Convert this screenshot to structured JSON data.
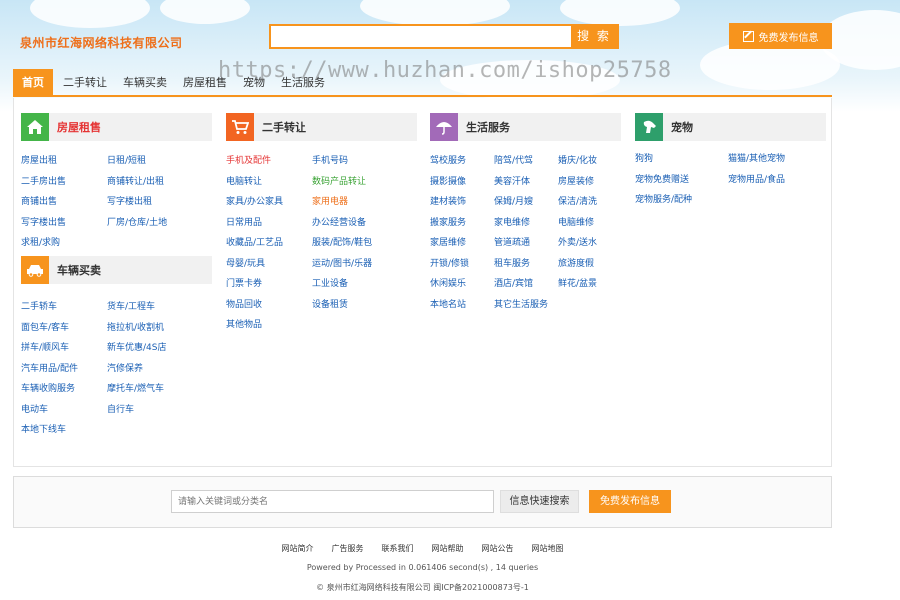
{
  "header": {
    "site_title": "泉州市红海网络科技有限公司",
    "search_placeholder": "",
    "search_button": "搜 索",
    "publish_button": "免费发布信息"
  },
  "watermark": "https://www.huzhan.com/ishop25758",
  "nav": {
    "items": [
      "首页",
      "二手转让",
      "车辆买卖",
      "房屋租售",
      "宠物",
      "生活服务"
    ]
  },
  "categories": {
    "house": {
      "title": "房屋租售",
      "links": [
        "房屋出租",
        "日租/短租",
        "二手房出售",
        "商铺转让/出租",
        "商铺出售",
        "写字楼出租",
        "写字楼出售",
        "厂房/仓库/土地",
        "求租/求购"
      ]
    },
    "vehicle": {
      "title": "车辆买卖",
      "links": [
        "二手轿车",
        "货车/工程车",
        "面包车/客车",
        "拖拉机/收割机",
        "拼车/顺风车",
        "新车优惠/4S店",
        "汽车用品/配件",
        "汽修保养",
        "车辆收购服务",
        "摩托车/燃气车",
        "电动车",
        "自行车",
        "本地下线车"
      ]
    },
    "secondhand": {
      "title": "二手转让",
      "links": [
        "手机及配件",
        "手机号码",
        "电脑转让",
        "数码产品转让",
        "家具/办公家具",
        "家用电器",
        "日常用品",
        "办公经营设备",
        "收藏品/工艺品",
        "服装/配饰/鞋包",
        "母婴/玩具",
        "运动/图书/乐器",
        "门票卡券",
        "工业设备",
        "物品回收",
        "设备租赁",
        "其他物品"
      ]
    },
    "life": {
      "title": "生活服务",
      "links": [
        "驾校服务",
        "陪驾/代驾",
        "婚庆/化妆",
        "摄影摄像",
        "美容汗体",
        "房屋装修",
        "建材装饰",
        "保姆/月嫂",
        "保洁/清洗",
        "搬家服务",
        "家电维修",
        "电脑维修",
        "家居维修",
        "管道疏通",
        "外卖/送水",
        "开锁/修锁",
        "租车服务",
        "旅游度假",
        "休闲娱乐",
        "酒店/宾馆",
        "鲜花/盆景",
        "本地名站",
        "其它生活服务"
      ]
    },
    "pets": {
      "title": "宠物",
      "links": [
        "狗狗",
        "猫猫/其他宠物",
        "宠物免费赠送",
        "宠物用品/食品",
        "宠物服务/配种"
      ]
    }
  },
  "bottom": {
    "placeholder": "请输入关键词或分类名",
    "quick_search": "信息快速搜索",
    "publish": "免费发布信息"
  },
  "footer": {
    "links": [
      "网站简介",
      "广告服务",
      "联系我们",
      "网站帮助",
      "网站公告",
      "网站地图"
    ],
    "processed": "Powered by Processed in 0.061406 second(s) , 14 queries",
    "copyright": "© 泉州市红海网络科技有限公司    闽ICP备2021000873号-1"
  },
  "colors": {
    "accent": "#f7941d",
    "house_icon": "#44b549",
    "vehicle_icon": "#f7941d",
    "secondhand_icon": "#f26522",
    "life_icon": "#a26ab8",
    "pets_icon": "#2e9f6b"
  }
}
